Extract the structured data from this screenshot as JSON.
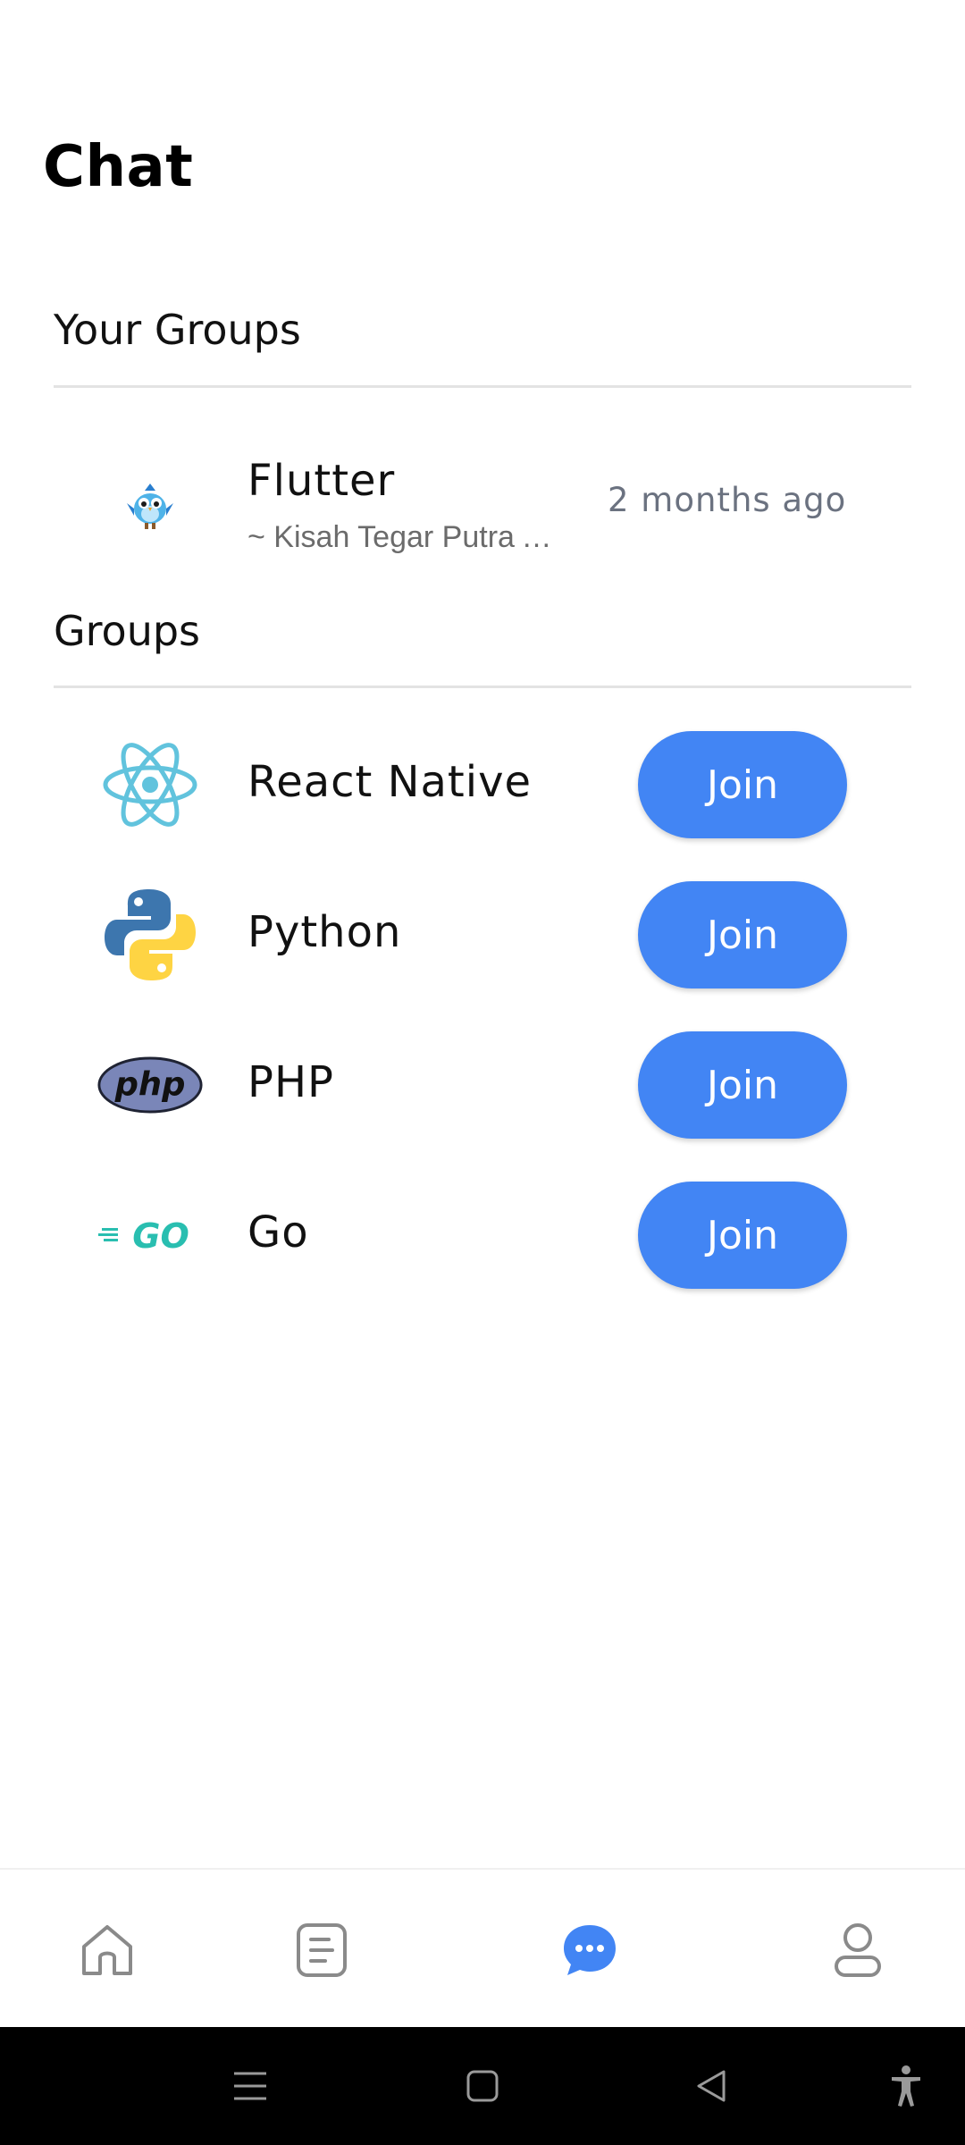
{
  "header": {
    "title": "Chat"
  },
  "your_groups": {
    "title": "Your Groups",
    "items": [
      {
        "name": "Flutter",
        "last_message": "~ Kisah Tegar Putra Abdi: Hello everyone",
        "time": "2 months ago",
        "icon": "flutter-bird-logo"
      }
    ]
  },
  "groups": {
    "title": "Groups",
    "items": [
      {
        "name": "React Native",
        "action": "Join",
        "icon": "react-logo"
      },
      {
        "name": "Python",
        "action": "Join",
        "icon": "python-logo"
      },
      {
        "name": "PHP",
        "action": "Join",
        "icon": "php-logo",
        "logo_text": "php"
      },
      {
        "name": "Go",
        "action": "Join",
        "icon": "go-logo",
        "logo_text": "GO"
      }
    ]
  },
  "bottom_nav": {
    "items": [
      {
        "icon": "home-icon",
        "active": false
      },
      {
        "icon": "document-icon",
        "active": false
      },
      {
        "icon": "chat-icon",
        "active": true
      },
      {
        "icon": "profile-icon",
        "active": false
      }
    ]
  },
  "system_nav": [
    "menu-icon",
    "home-square-icon",
    "back-icon",
    "accessibility-icon"
  ],
  "colors": {
    "accent": "#4285f4",
    "muted": "#6b7280",
    "divider": "#e3e3e3"
  }
}
